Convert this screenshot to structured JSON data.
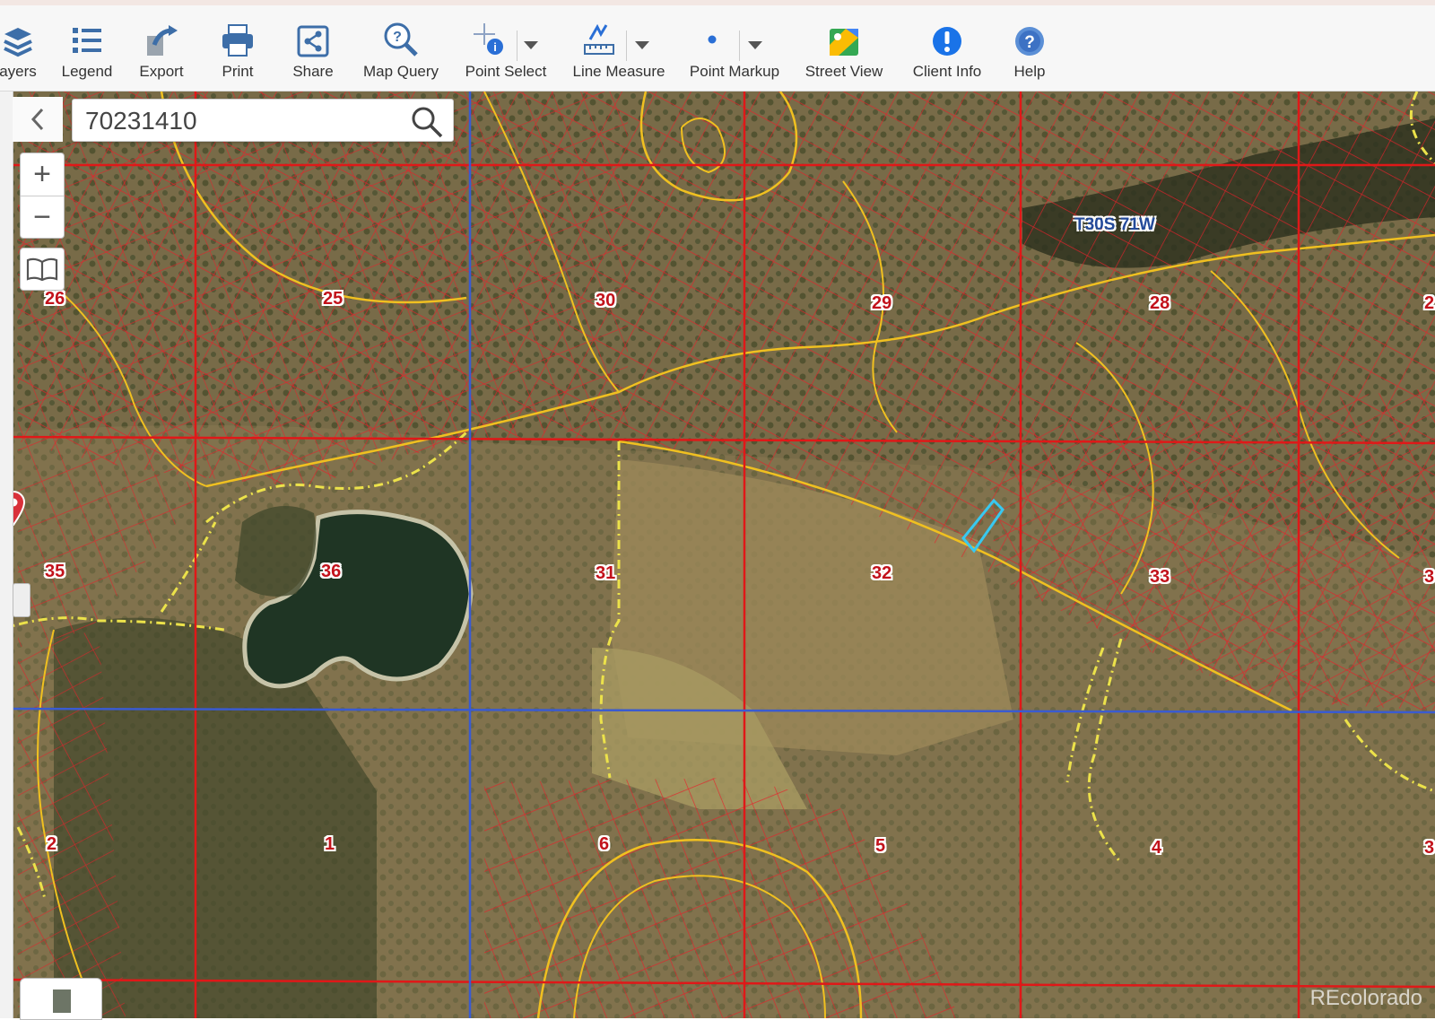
{
  "toolbar": {
    "items": [
      {
        "label": "ayers",
        "icon": "layers-icon"
      },
      {
        "label": "Legend",
        "icon": "legend-icon"
      },
      {
        "label": "Export",
        "icon": "export-icon"
      },
      {
        "label": "Print",
        "icon": "print-icon"
      },
      {
        "label": "Share",
        "icon": "share-icon"
      },
      {
        "label": "Map Query",
        "icon": "map-query-icon"
      },
      {
        "label": "Point Select",
        "icon": "point-select-icon"
      },
      {
        "label": "Line Measure",
        "icon": "line-measure-icon"
      },
      {
        "label": "Point Markup",
        "icon": "point-markup-icon"
      },
      {
        "label": "Street View",
        "icon": "street-view-icon"
      },
      {
        "label": "Client Info",
        "icon": "client-info-icon"
      },
      {
        "label": "Help",
        "icon": "help-icon"
      }
    ]
  },
  "search": {
    "value": "70231410"
  },
  "zoom": {
    "in_label": "+",
    "out_label": "−"
  },
  "map": {
    "township_label": "T30S 71W",
    "sections": {
      "s26": "26",
      "s25": "25",
      "s30": "30",
      "s29": "29",
      "s28": "28",
      "s35": "35",
      "s36": "36",
      "s31": "31",
      "s32": "32",
      "s33": "33",
      "s1": "1",
      "s6": "6",
      "s5": "5",
      "s4": "4",
      "s2": "2",
      "e2": "2",
      "e3": "3",
      "e3b": "3"
    },
    "watermark": "REcolorado"
  },
  "colors": {
    "parcel_line": "#e8202a",
    "road_line": "#f0c020",
    "section_line": "#e01818",
    "township_line": "#3a5bd0",
    "boundary_dash": "#ece24a",
    "selected_parcel": "#38c8f0",
    "pin": "#d9313a"
  }
}
